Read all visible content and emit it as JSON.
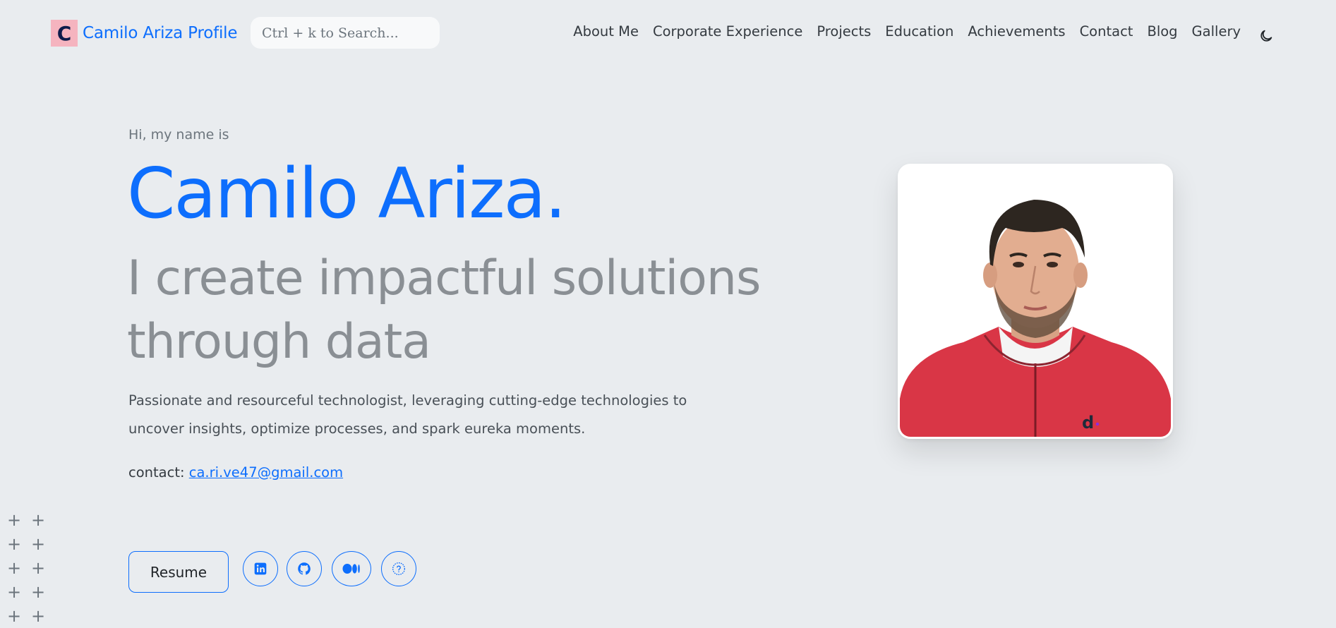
{
  "navbar": {
    "logo_letter": "C",
    "brand_name": "Camilo Ariza Profile",
    "search_placeholder": "Ctrl + k to Search...",
    "links": [
      "About Me",
      "Corporate Experience",
      "Projects",
      "Education",
      "Achievements",
      "Contact",
      "Blog",
      "Gallery"
    ],
    "theme_icon": "moon-icon"
  },
  "hero": {
    "intro": "Hi, my name is",
    "name": "Camilo Ariza.",
    "tagline": "I create impactful solutions through data",
    "description": "Passionate and resourceful technologist, leveraging cutting-edge technologies to uncover insights, optimize processes, and spark eureka moments.",
    "contact_label": "contact:",
    "contact_email": "ca.ri.ve47@gmail.com"
  },
  "actions": {
    "resume_label": "Resume",
    "social_icons": [
      "linkedin-icon",
      "github-icon",
      "medium-icon",
      "help-icon"
    ]
  },
  "photo": {
    "watermark": "d"
  },
  "colors": {
    "accent": "#0d6efd",
    "background": "#e9ecef",
    "logo_bg": "#f5b4bf",
    "tagline": "#8a8f94"
  }
}
